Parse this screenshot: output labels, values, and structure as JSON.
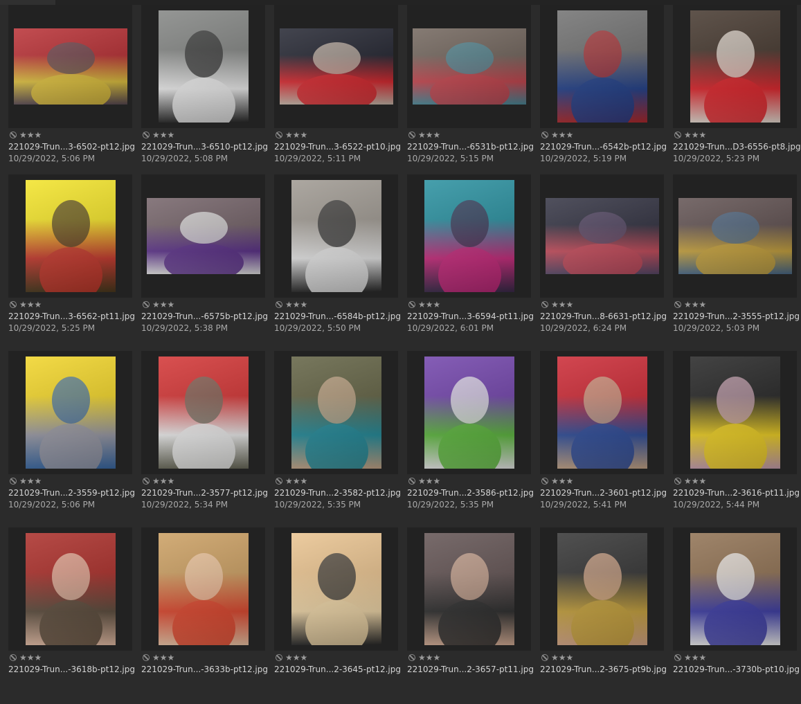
{
  "rating_stars": "★★★",
  "colors": {
    "background": "#2b2b2b",
    "thumb_frame": "#222222",
    "filename_text": "#d4d4d4",
    "date_text": "#a9a9a9"
  },
  "items": [
    {
      "filename": "221029-Trun...3-6502-pt12.jpg",
      "date": "10/29/2022, 5:06 PM",
      "orientation": "landscape",
      "palette": [
        "#b5262b",
        "#e0c23a",
        "#5a4a52"
      ]
    },
    {
      "filename": "221029-Trun...3-6510-pt12.jpg",
      "date": "10/29/2022, 5:08 PM",
      "orientation": "portrait",
      "palette": [
        "#7d7f7d",
        "#f2f2f2",
        "#2a2a2a"
      ]
    },
    {
      "filename": "221029-Trun...3-6522-pt10.jpg",
      "date": "10/29/2022, 5:11 PM",
      "orientation": "landscape",
      "palette": [
        "#1a1c28",
        "#d8232a",
        "#c9b8aa"
      ]
    },
    {
      "filename": "221029-Trun...-6531b-pt12.jpg",
      "date": "10/29/2022, 5:15 PM",
      "orientation": "landscape",
      "palette": [
        "#6b5e55",
        "#c4414a",
        "#4a8a9a"
      ]
    },
    {
      "filename": "221029-Trun...-6542b-pt12.jpg",
      "date": "10/29/2022, 5:19 PM",
      "orientation": "portrait",
      "palette": [
        "#6a6a6a",
        "#1d3d8a",
        "#b02a2e"
      ]
    },
    {
      "filename": "221029-Trun...D3-6556-pt8.jpg",
      "date": "10/29/2022, 5:23 PM",
      "orientation": "portrait",
      "palette": [
        "#3c2e24",
        "#e02027",
        "#eae0d6"
      ]
    },
    {
      "filename": "221029-Trun...3-6562-pt11.jpg",
      "date": "10/29/2022, 5:25 PM",
      "orientation": "portrait",
      "palette": [
        "#f2e21e",
        "#c8362a",
        "#4a3a1e"
      ]
    },
    {
      "filename": "221029-Trun...-6575b-pt12.jpg",
      "date": "10/29/2022, 5:38 PM",
      "orientation": "landscape",
      "palette": [
        "#6e5c62",
        "#5a2e8a",
        "#e6e6e6"
      ]
    },
    {
      "filename": "221029-Trun...-6584b-pt12.jpg",
      "date": "10/29/2022, 5:50 PM",
      "orientation": "portrait",
      "palette": [
        "#9a948c",
        "#eaeaea",
        "#2a2a2a"
      ]
    },
    {
      "filename": "221029-Trun...3-6594-pt11.jpg",
      "date": "10/29/2022, 6:01 PM",
      "orientation": "portrait",
      "palette": [
        "#1e8a9a",
        "#c8267a",
        "#3a2a4a"
      ]
    },
    {
      "filename": "221029-Trun...8-6631-pt12.jpg",
      "date": "10/29/2022, 6:24 PM",
      "orientation": "landscape",
      "palette": [
        "#2a2a3a",
        "#c84a5a",
        "#5a4a6a"
      ]
    },
    {
      "filename": "221029-Trun...2-3555-pt12.jpg",
      "date": "10/29/2022, 5:03 PM",
      "orientation": "landscape",
      "palette": [
        "#5a4a4a",
        "#c8a23a",
        "#4a6a8a"
      ]
    },
    {
      "filename": "221029-Trun...2-3559-pt12.jpg",
      "date": "10/29/2022, 5:06 PM",
      "orientation": "portrait",
      "palette": [
        "#f0d21e",
        "#9a9aa6",
        "#3a6aa6"
      ]
    },
    {
      "filename": "221029-Trun...2-3577-pt12.jpg",
      "date": "10/29/2022, 5:34 PM",
      "orientation": "portrait",
      "palette": [
        "#d02a2a",
        "#f2f2f2",
        "#6a6a5a"
      ]
    },
    {
      "filename": "221029-Trun...2-3582-pt12.jpg",
      "date": "10/29/2022, 5:35 PM",
      "orientation": "portrait",
      "palette": [
        "#5a5a3a",
        "#1e8a9a",
        "#c8a88a"
      ]
    },
    {
      "filename": "221029-Trun...2-3586-pt12.jpg",
      "date": "10/29/2022, 5:35 PM",
      "orientation": "portrait",
      "palette": [
        "#6a3aa6",
        "#5ab83a",
        "#eaeaea"
      ]
    },
    {
      "filename": "221029-Trun...2-3601-pt12.jpg",
      "date": "10/29/2022, 5:41 PM",
      "orientation": "portrait",
      "palette": [
        "#c81e2a",
        "#2a4a9a",
        "#c8a88a"
      ]
    },
    {
      "filename": "221029-Trun...2-3616-pt11.jpg",
      "date": "10/29/2022, 5:44 PM",
      "orientation": "portrait",
      "palette": [
        "#1a1a1a",
        "#f2d21e",
        "#c8a0b0"
      ]
    },
    {
      "filename": "221029-Trun...-3618b-pt12.jpg",
      "date": "",
      "orientation": "portrait",
      "palette": [
        "#a6231e",
        "#5a4a3a",
        "#e8c0a8"
      ]
    },
    {
      "filename": "221029-Trun...-3633b-pt12.jpg",
      "date": "",
      "orientation": "portrait",
      "palette": [
        "#c89a5a",
        "#e0442a",
        "#f0c8a8"
      ]
    },
    {
      "filename": "221029-Trun...2-3645-pt12.jpg",
      "date": "",
      "orientation": "portrait",
      "palette": [
        "#e8c08a",
        "#f2d8a8",
        "#2a2a2a"
      ]
    },
    {
      "filename": "221029-Trun...2-3657-pt11.jpg",
      "date": "",
      "orientation": "portrait",
      "palette": [
        "#5a4a4a",
        "#2a2a2a",
        "#d8b098"
      ]
    },
    {
      "filename": "221029-Trun...2-3675-pt9b.jpg",
      "date": "",
      "orientation": "portrait",
      "palette": [
        "#2a2a2a",
        "#c8a23a",
        "#d8a888"
      ]
    },
    {
      "filename": "221029-Trun...-3730b-pt10.jpg",
      "date": "",
      "orientation": "portrait",
      "palette": [
        "#8a6a4a",
        "#3a3aa6",
        "#f2f2f2"
      ]
    }
  ]
}
